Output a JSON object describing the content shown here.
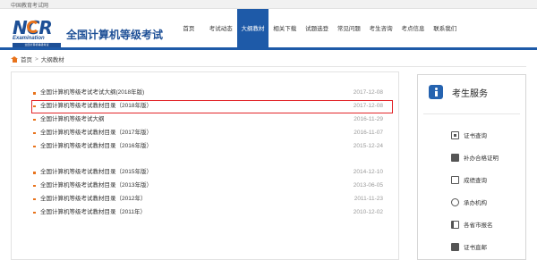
{
  "topbar": {
    "text": "中国教育考试网"
  },
  "logo": {
    "letters": "NCR",
    "sub": "Examination",
    "tag": "全国计算机等级考试"
  },
  "header": {
    "title": "全国计算机等级考试"
  },
  "nav": [
    {
      "label": "首页"
    },
    {
      "label": "考试动态"
    },
    {
      "label": "大纲教材",
      "active": true
    },
    {
      "label": "相关下载"
    },
    {
      "label": "试题选登"
    },
    {
      "label": "常见问题"
    },
    {
      "label": "考生咨询"
    },
    {
      "label": "考点信息"
    },
    {
      "label": "联系我们"
    }
  ],
  "breadcrumb": {
    "home": "首页",
    "separator": ">",
    "current": "大纲教材"
  },
  "list_a": [
    {
      "title": "全国计算机等级考试考试大纲(2018年版)",
      "date": "2017-12-08"
    },
    {
      "title": "全国计算机等级考试教材目录（2018年版）",
      "date": "2017-12-08"
    },
    {
      "title": "全国计算机等级考试大纲",
      "date": "2016-11-29"
    },
    {
      "title": "全国计算机等级考试教材目录（2017年版）",
      "date": "2016-11-07"
    },
    {
      "title": "全国计算机等级考试教材目录（2016年版）",
      "date": "2015-12-24"
    }
  ],
  "list_b": [
    {
      "title": "全国计算机等级考试教材目录（2015年版）",
      "date": "2014-12-10"
    },
    {
      "title": "全国计算机等级考试教材目录（2013年版）",
      "date": "2013-06-05"
    },
    {
      "title": "全国计算机等级考试教材目录（2012年）",
      "date": "2011-11-23"
    },
    {
      "title": "全国计算机等级考试教材目录（2011年）",
      "date": "2010-12-02"
    }
  ],
  "side": {
    "title": "考生服务",
    "items": [
      {
        "label": "证书查询",
        "icon": "certificate-icon"
      },
      {
        "label": "补办合格证明",
        "icon": "certificate-reissue-icon"
      },
      {
        "label": "成绩查询",
        "icon": "edit-icon"
      },
      {
        "label": "承办机构",
        "icon": "institution-icon"
      },
      {
        "label": "各省市报名",
        "icon": "registration-icon"
      },
      {
        "label": "证书直邮",
        "icon": "mail-icon"
      }
    ]
  },
  "colors": {
    "brand_blue": "#1e5aa8",
    "accent_orange": "#e8731c",
    "highlight_red": "#e3262a"
  }
}
